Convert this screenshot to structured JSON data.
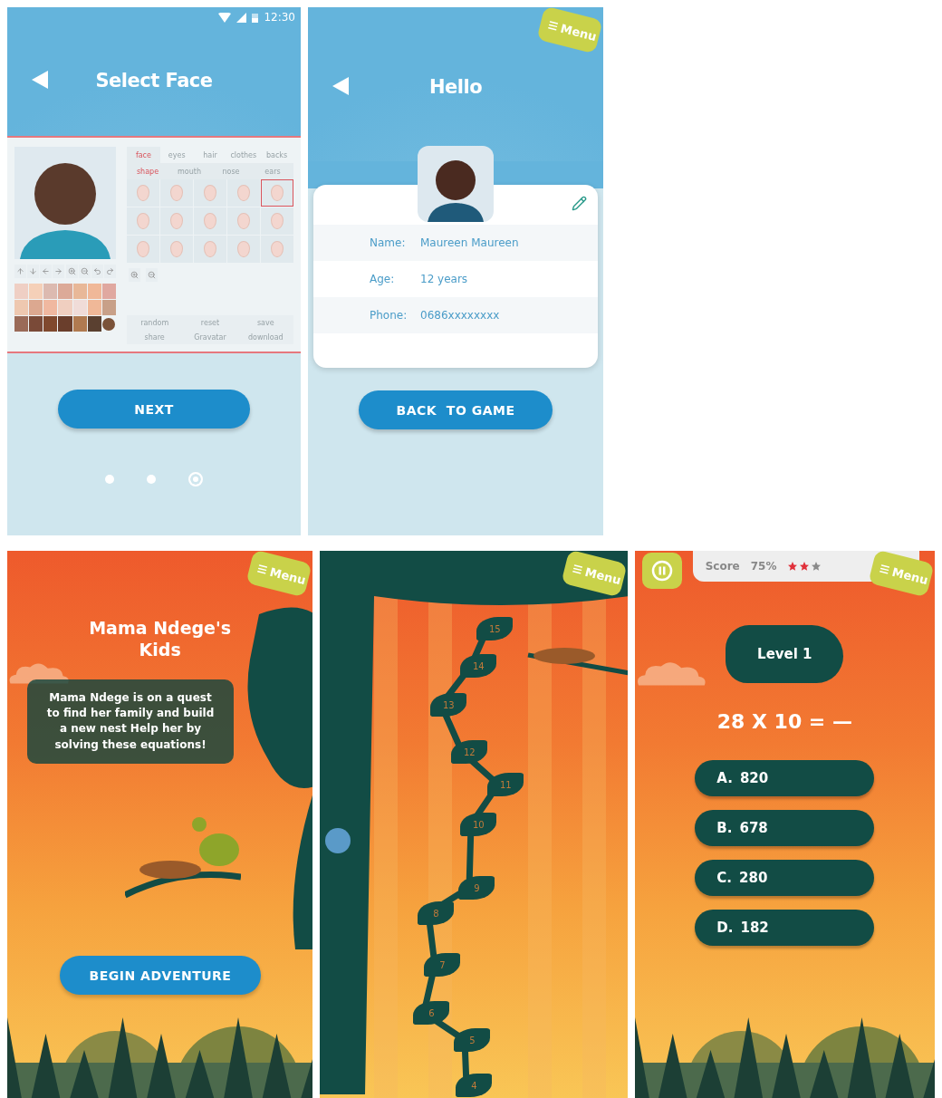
{
  "select_face": {
    "status_bar": {
      "time": "12:30"
    },
    "title": "Select Face",
    "editor": {
      "tabs": [
        {
          "label": "face",
          "selected": true
        },
        {
          "label": "eyes",
          "selected": false
        },
        {
          "label": "hair",
          "selected": false
        },
        {
          "label": "clothes",
          "selected": false
        },
        {
          "label": "backs",
          "selected": false
        }
      ],
      "subtabs": [
        {
          "label": "shape",
          "selected": true
        },
        {
          "label": "mouth",
          "selected": false
        },
        {
          "label": "nose",
          "selected": false
        },
        {
          "label": "ears",
          "selected": false
        }
      ],
      "shapes": [
        {
          "selected": false
        },
        {
          "selected": false
        },
        {
          "selected": false
        },
        {
          "selected": false
        },
        {
          "selected": true
        },
        {
          "selected": false
        },
        {
          "selected": false
        },
        {
          "selected": false
        },
        {
          "selected": false
        },
        {
          "selected": false
        },
        {
          "selected": false
        },
        {
          "selected": false
        },
        {
          "selected": false
        },
        {
          "selected": false
        },
        {
          "selected": false
        }
      ],
      "swatches": [
        {
          "color": "#efcfc4"
        },
        {
          "color": "#f5d0b8"
        },
        {
          "color": "#dcbab0"
        },
        {
          "color": "#dcaa98"
        },
        {
          "color": "#e8b898"
        },
        {
          "color": "#f0b898"
        },
        {
          "color": "#e0a8a0"
        },
        {
          "color": "#eec8b0"
        },
        {
          "color": "#dca890"
        },
        {
          "color": "#f0b8a0"
        },
        {
          "color": "#f0cfc0"
        },
        {
          "color": "#f0dcd8"
        },
        {
          "color": "#f0b898"
        },
        {
          "color": "#c8a088"
        },
        {
          "color": "#9a6a58"
        },
        {
          "color": "#7a4a38"
        },
        {
          "color": "#80492e"
        },
        {
          "color": "#6a3e2c"
        },
        {
          "color": "#b07a50"
        },
        {
          "color": "#5a4030"
        },
        {
          "color": "#7a5238",
          "kind": "round"
        }
      ],
      "actions": [
        "random",
        "reset",
        "save",
        "share",
        "Gravatar",
        "download"
      ]
    },
    "next_button": "NEXT",
    "pager": [
      {
        "selected": false
      },
      {
        "selected": false
      },
      {
        "selected": true
      }
    ]
  },
  "profile": {
    "menu": "Menu",
    "title": "Hello",
    "fields": [
      {
        "label": "Name:",
        "value": "Maureen Maureen"
      },
      {
        "label": "Age:",
        "value": "12 years"
      },
      {
        "label": "Phone:",
        "value": "0686xxxxxxxx"
      }
    ],
    "button": "BACK  TO GAME"
  },
  "intro": {
    "menu": "Menu",
    "title": "Mama Ndege's Kids",
    "message": "Mama Ndege is on a quest to find her family and  build a new nest Help her by solving these equations!",
    "button": "BEGIN ADVENTURE"
  },
  "map": {
    "menu": "Menu",
    "levels": [
      "15",
      "14",
      "13",
      "12",
      "11",
      "10",
      "9",
      "8",
      "7",
      "6",
      "5",
      "4"
    ]
  },
  "quiz": {
    "score_label": "Score",
    "score": "75%",
    "stars": 2,
    "menu": "Menu",
    "level": "Level 1",
    "question": "28 X 10 = —",
    "answers": [
      {
        "letter": "A.",
        "text": "820"
      },
      {
        "letter": "B.",
        "text": "678"
      },
      {
        "letter": "C.",
        "text": "280"
      },
      {
        "letter": "D.",
        "text": "182"
      }
    ]
  }
}
